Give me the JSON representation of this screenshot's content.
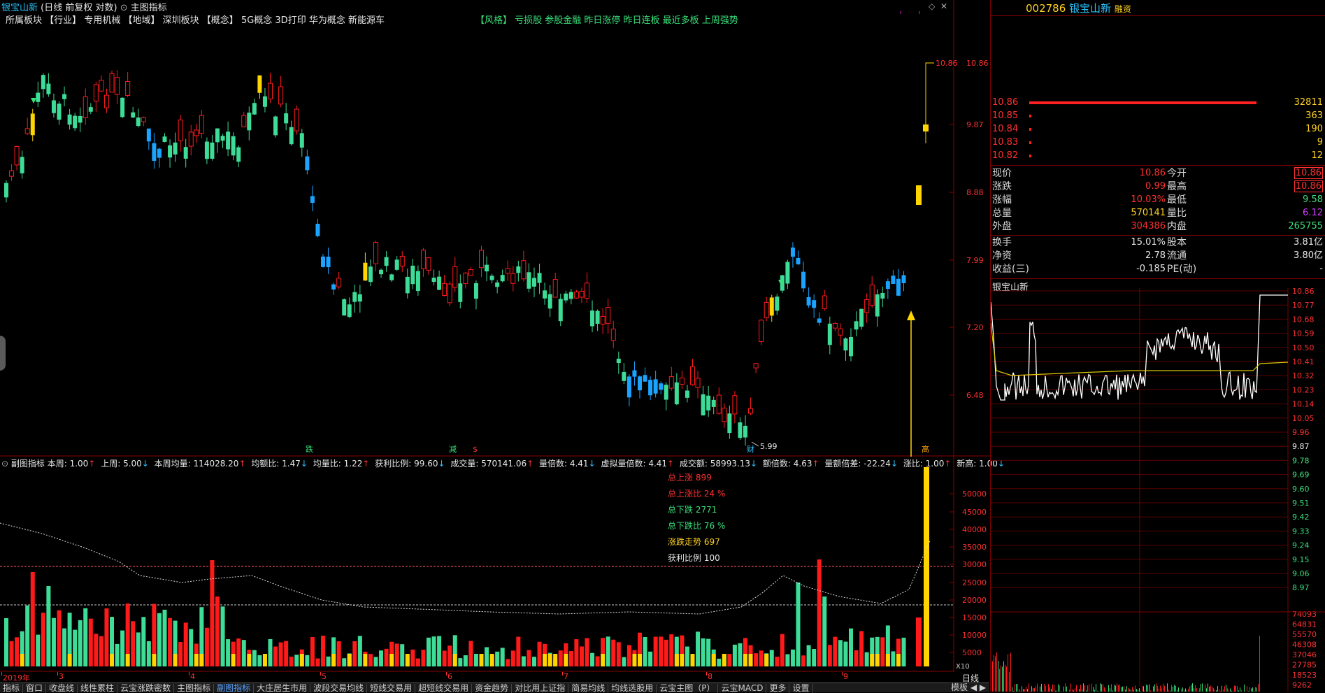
{
  "header": {
    "stock_name": "银宝山新",
    "mode": "(日线 前复权 对数)",
    "main_indicator": "主图指标",
    "sector_label": "所属板块",
    "industry_tag": "【行业】",
    "industry": "专用机械",
    "region_tag": "【地域】",
    "region": "深圳板块",
    "concept_tag": "【概念】",
    "concepts": "5G概念 3D打印 华为概念 新能源车",
    "style_tag": "【风格】",
    "styles": "亏损股 参股金融 昨日涨停 昨日连板 最近多板 上周强势"
  },
  "main_axis": {
    "ticks": [
      "10.86",
      "9.87",
      "8.88",
      "7.99",
      "7.20",
      "6.48"
    ],
    "high_value": "10.86",
    "low_value": "5.99"
  },
  "markers": {
    "m1": "跌",
    "m2": "减",
    "m3": "$",
    "m4": "财",
    "m5": "高"
  },
  "sub_indicator": {
    "title": "副图指标",
    "items": [
      {
        "label": "本周:",
        "value": "1.00"
      },
      {
        "label": "上周:",
        "value": "5.00"
      },
      {
        "label": "本周均量:",
        "value": "114028.20"
      },
      {
        "label": "均额比:",
        "value": "1.47"
      },
      {
        "label": "均量比:",
        "value": "1.22"
      },
      {
        "label": "获利比例:",
        "value": "99.60"
      },
      {
        "label": "成交量:",
        "value": "570141.06"
      },
      {
        "label": "量倍数:",
        "value": "4.41"
      },
      {
        "label": "虚拟量倍数:",
        "value": "4.41"
      },
      {
        "label": "成交额:",
        "value": "58993.13"
      },
      {
        "label": "额倍数:",
        "value": "4.63"
      },
      {
        "label": "量额倍差:",
        "value": "-22.24"
      },
      {
        "label": "涨比:",
        "value": "1.00"
      },
      {
        "label": "新高:",
        "value": "1.00"
      }
    ],
    "stats": [
      {
        "text": "总上涨 899",
        "color": "#ff3030"
      },
      {
        "text": "总上涨比 24 %",
        "color": "#ff3030"
      },
      {
        "text": "总下跌 2771",
        "color": "#39e07a"
      },
      {
        "text": "总下跌比 76 %",
        "color": "#39e07a"
      },
      {
        "text": "涨跌走势 697",
        "color": "#ffd21f"
      },
      {
        "text": "获利比例 100",
        "color": "#e6e6e6"
      }
    ]
  },
  "vol_axis": {
    "ticks": [
      "50000",
      "45000",
      "40000",
      "35000",
      "30000",
      "25000",
      "20000",
      "15000",
      "10000",
      "5000"
    ],
    "unit": "X10",
    "period": "日线"
  },
  "time_axis": [
    "2019年",
    "3",
    "4",
    "5",
    "6",
    "7",
    "8",
    "9"
  ],
  "tabs": [
    "指标",
    "窗口",
    "收盘线",
    "线性累柱",
    "云宝涨跌密数",
    "主图指标",
    "副图指标",
    "大庄居生市用",
    "波段交易均线",
    "短线交易用",
    "超短线交易用",
    "资金趋势",
    "对比用上证指",
    "简易均线",
    "均线选股用",
    "云宝主图（P）",
    "云宝MACD",
    "更多",
    "设置"
  ],
  "tabs_right": "模板",
  "active_tab": "副图指标",
  "quote": {
    "code": "002786",
    "name": "银宝山新",
    "tag": "融资",
    "book": [
      {
        "price": "10.86",
        "vol": "32811"
      },
      {
        "price": "10.85",
        "vol": "363"
      },
      {
        "price": "10.84",
        "vol": "190"
      },
      {
        "price": "10.83",
        "vol": "9"
      },
      {
        "price": "10.82",
        "vol": "12"
      }
    ],
    "stats": [
      {
        "l1": "现价",
        "v1": "10.86",
        "l2": "今开",
        "v2": "10.86"
      },
      {
        "l1": "涨跌",
        "v1": "0.99",
        "l2": "最高",
        "v2": "10.86"
      },
      {
        "l1": "涨幅",
        "v1": "10.03%",
        "l2": "最低",
        "v2": "9.58"
      },
      {
        "l1": "总量",
        "v1": "570141",
        "l2": "量比",
        "v2": "6.12"
      },
      {
        "l1": "外盘",
        "v1": "304386",
        "l2": "内盘",
        "v2": "265755"
      }
    ],
    "stats2": [
      {
        "l1": "换手",
        "v1": "15.01%",
        "l2": "股本",
        "v2": "3.81亿"
      },
      {
        "l1": "净资",
        "v1": "2.78",
        "l2": "流通",
        "v2": "3.80亿"
      },
      {
        "l1": "收益(三)",
        "v1": "-0.185",
        "l2": "PE(动)",
        "v2": "-"
      }
    ],
    "intraday_title": "银宝山新",
    "intraday_axis": [
      "10.86",
      "10.77",
      "10.68",
      "10.59",
      "10.50",
      "10.41",
      "10.32",
      "10.23",
      "10.14",
      "10.05",
      "9.96",
      "9.87",
      "9.78",
      "9.69",
      "9.60",
      "9.51",
      "9.42",
      "9.33",
      "9.24",
      "9.15",
      "9.06",
      "8.97"
    ],
    "intraday_vol_axis": [
      "74093",
      "64831",
      "55570",
      "46308",
      "37046",
      "27785",
      "18523",
      "9262"
    ]
  }
}
